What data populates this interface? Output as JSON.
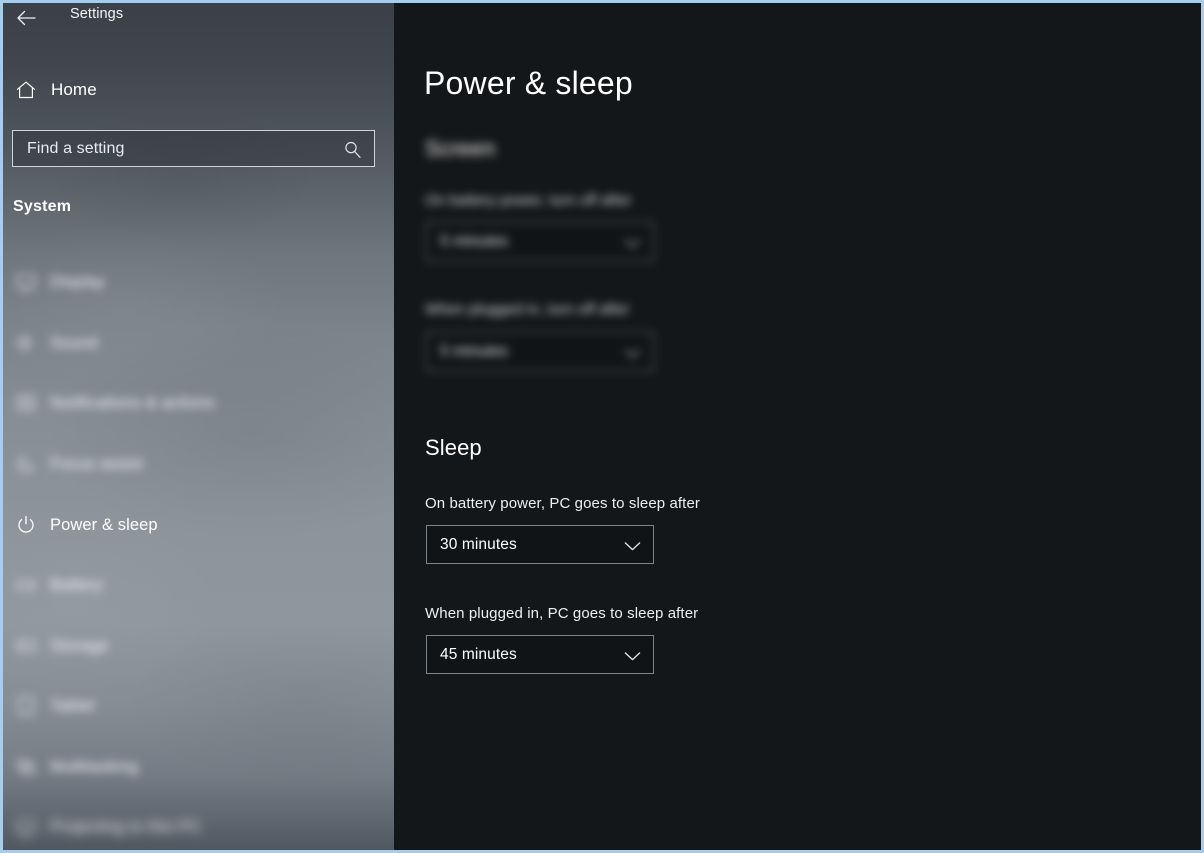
{
  "window": {
    "title": "Settings",
    "back_icon": "back-arrow-icon",
    "border_color": "#a9cde9",
    "content_bg": "#141719"
  },
  "sidebar": {
    "home": {
      "label": "Home",
      "icon": "home-icon"
    },
    "search": {
      "placeholder": "Find a setting",
      "value": "Find a setting",
      "icon": "search-icon"
    },
    "group_label": "System",
    "items": [
      {
        "label": "Display",
        "icon": "display-icon",
        "blurred": true,
        "selected": false
      },
      {
        "label": "Sound",
        "icon": "sound-icon",
        "blurred": true,
        "selected": false
      },
      {
        "label": "Notifications & actions",
        "icon": "notifications-icon",
        "blurred": true,
        "selected": false
      },
      {
        "label": "Focus assist",
        "icon": "focus-assist-icon",
        "blurred": true,
        "selected": false
      },
      {
        "label": "Power & sleep",
        "icon": "power-icon",
        "blurred": false,
        "selected": true
      },
      {
        "label": "Battery",
        "icon": "battery-icon",
        "blurred": true,
        "selected": false
      },
      {
        "label": "Storage",
        "icon": "storage-icon",
        "blurred": true,
        "selected": false
      },
      {
        "label": "Tablet",
        "icon": "tablet-icon",
        "blurred": true,
        "selected": false
      },
      {
        "label": "Multitasking",
        "icon": "multitasking-icon",
        "blurred": true,
        "selected": false
      },
      {
        "label": "Projecting to this PC",
        "icon": "projecting-icon",
        "blurred": true,
        "selected": false
      }
    ]
  },
  "main": {
    "page_title": "Power & sleep",
    "screen_section": {
      "heading": "Screen",
      "battery_label": "On battery power, turn off after",
      "battery_value": "5 minutes",
      "plugged_label": "When plugged in, turn off after",
      "plugged_value": "5 minutes"
    },
    "sleep_section": {
      "heading": "Sleep",
      "battery_label": "On battery power, PC goes to sleep after",
      "battery_value": "30 minutes",
      "plugged_label": "When plugged in, PC goes to sleep after",
      "plugged_value": "45 minutes"
    }
  }
}
